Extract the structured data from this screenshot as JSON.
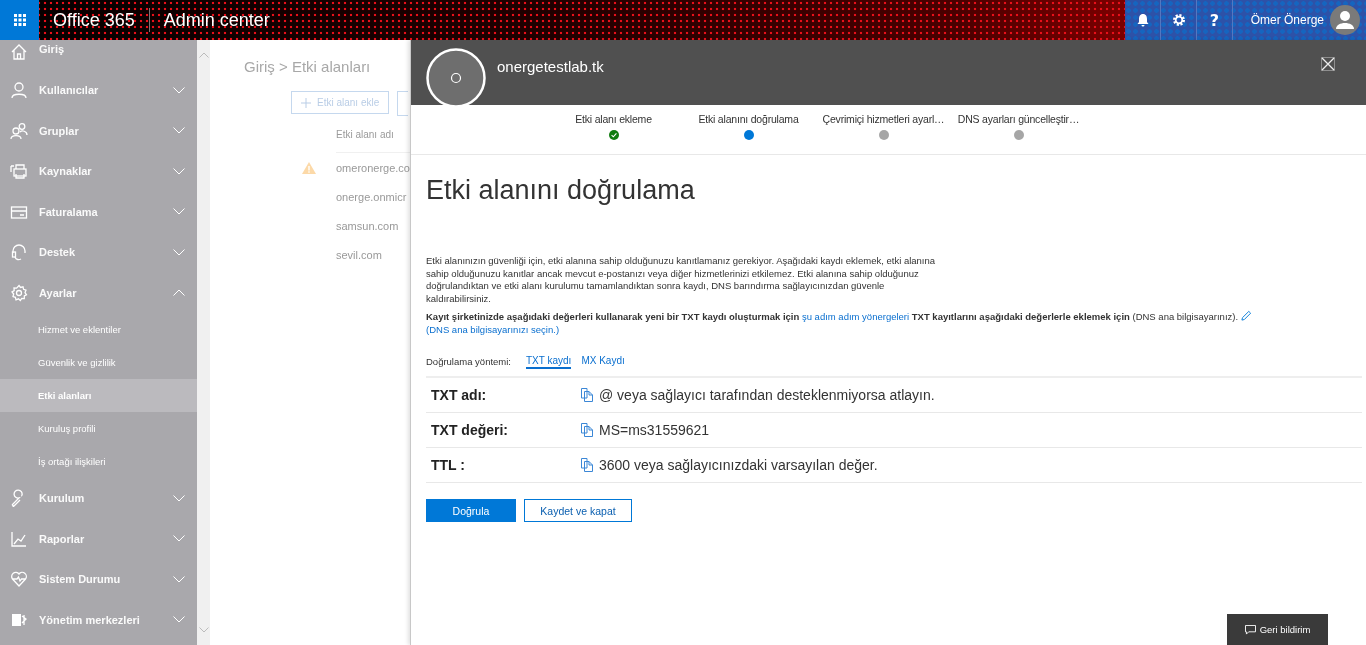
{
  "header": {
    "app_name": "Office 365",
    "section": "Admin center",
    "help_label": "?",
    "user_name": "Ömer Önerge"
  },
  "sidebar": {
    "items": [
      {
        "label": "Giriş",
        "kind": "link"
      },
      {
        "label": "Kullanıcılar",
        "kind": "group",
        "expanded": false
      },
      {
        "label": "Gruplar",
        "kind": "group",
        "expanded": false
      },
      {
        "label": "Kaynaklar",
        "kind": "group",
        "expanded": false
      },
      {
        "label": "Faturalama",
        "kind": "group",
        "expanded": false
      },
      {
        "label": "Destek",
        "kind": "group",
        "expanded": false
      },
      {
        "label": "Ayarlar",
        "kind": "group",
        "expanded": true,
        "children": [
          {
            "label": "Hizmet ve eklentiler",
            "selected": false
          },
          {
            "label": "Güvenlik ve gizlilik",
            "selected": false
          },
          {
            "label": "Etki alanları",
            "selected": true
          },
          {
            "label": "Kuruluş profili",
            "selected": false
          },
          {
            "label": "İş ortağı ilişkileri",
            "selected": false
          }
        ]
      },
      {
        "label": "Kurulum",
        "kind": "group",
        "expanded": false
      },
      {
        "label": "Raporlar",
        "kind": "group",
        "expanded": false
      },
      {
        "label": "Sistem Durumu",
        "kind": "group",
        "expanded": false
      },
      {
        "label": "Yönetim merkezleri",
        "kind": "group",
        "expanded": false
      }
    ]
  },
  "background_page": {
    "breadcrumb": "Giriş > Etki alanları",
    "add_button": "Etki alanı ekle",
    "column_header": "Etki alanı adı",
    "rows": [
      {
        "name": "omeronerge.co",
        "warning": true
      },
      {
        "name": "onerge.onmicr",
        "warning": false
      },
      {
        "name": "samsun.com",
        "warning": false
      },
      {
        "name": "sevil.com",
        "warning": false
      }
    ]
  },
  "panel": {
    "domain": "onergetestlab.tk",
    "steps": [
      {
        "label": "Etki alanı ekleme",
        "completed": true,
        "selected": false
      },
      {
        "label": "Etki alanını doğrulama",
        "completed": false,
        "selected": true
      },
      {
        "label": "Çevrimiçi hizmetleri ayarl…",
        "completed": false,
        "selected": false
      },
      {
        "label": "DNS ayarları güncelleştir…",
        "completed": false,
        "selected": false
      }
    ],
    "title": "Etki alanını doğrulama",
    "description": "Etki alanınızın güvenliği için, etki alanına sahip olduğunuzu kanıtlamanız gerekiyor. Aşağıdaki kaydı eklemek, etki alanına sahip olduğunuzu kanıtlar ancak mevcut e-postanızı veya diğer hizmetlerinizi etkilemez. Etki alanına sahip olduğunuz doğrulandıktan ve etki alanı kurulumu tamamlandıktan sonra kaydı, DNS barındırma sağlayıcınızdan güvenle kaldırabilirsiniz.",
    "instruction": [
      {
        "kind": "text",
        "text": "**Kayıt şirketinizde aşağıdaki değerleri kullanarak yeni bir TXT kaydı oluşturmak için** "
      },
      {
        "kind": "link",
        "text": "şu adım adım yönergeleri"
      },
      {
        "kind": "text",
        "text": " **TXT kayıtlarını aşağıdaki değerlerle eklemek için** (DNS ana bilgisayarınız). "
      },
      {
        "kind": "edit"
      },
      {
        "kind": "link",
        "text": "(DNS ana bilgisayarınızı seçin.)"
      }
    ],
    "method_label": "Doğrulama yöntemi:",
    "methods": [
      {
        "label": "TXT kaydı",
        "selected": true
      },
      {
        "label": "MX Kaydı",
        "selected": false
      }
    ],
    "records": [
      {
        "label": "TXT adı:",
        "value": "@ veya sağlayıcı tarafından desteklenmiyorsa atlayın."
      },
      {
        "label": "TXT değeri:",
        "value": "MS=ms31559621"
      },
      {
        "label": "TTL :",
        "value": "3600 veya sağlayıcınızdaki varsayılan değer."
      }
    ],
    "buttons": [
      {
        "label": "Doğrula",
        "kind": "primary"
      },
      {
        "label": "Kaydet ve kapat",
        "kind": "secondary"
      }
    ]
  },
  "feedback_button": "Geri bildirim"
}
